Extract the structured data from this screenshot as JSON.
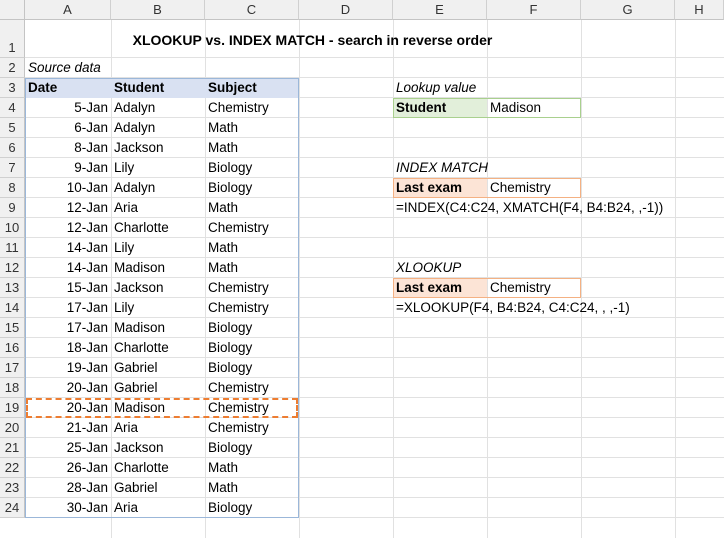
{
  "columns": [
    "A",
    "B",
    "C",
    "D",
    "E",
    "F",
    "G",
    "H"
  ],
  "rows": [
    "1",
    "2",
    "3",
    "4",
    "5",
    "6",
    "7",
    "8",
    "9",
    "10",
    "11",
    "12",
    "13",
    "14",
    "15",
    "16",
    "17",
    "18",
    "19",
    "20",
    "21",
    "22",
    "23",
    "24"
  ],
  "title": "XLOOKUP vs. INDEX MATCH - search in reverse order",
  "source_label": "Source data",
  "table": {
    "headers": [
      "Date",
      "Student",
      "Subject"
    ],
    "rows": [
      [
        "5-Jan",
        "Adalyn",
        "Chemistry"
      ],
      [
        "6-Jan",
        "Adalyn",
        "Math"
      ],
      [
        "8-Jan",
        "Jackson",
        "Math"
      ],
      [
        "9-Jan",
        "Lily",
        "Biology"
      ],
      [
        "10-Jan",
        "Adalyn",
        "Biology"
      ],
      [
        "12-Jan",
        "Aria",
        "Math"
      ],
      [
        "12-Jan",
        "Charlotte",
        "Chemistry"
      ],
      [
        "14-Jan",
        "Lily",
        "Math"
      ],
      [
        "14-Jan",
        "Madison",
        "Math"
      ],
      [
        "15-Jan",
        "Jackson",
        "Chemistry"
      ],
      [
        "17-Jan",
        "Lily",
        "Chemistry"
      ],
      [
        "17-Jan",
        "Madison",
        "Biology"
      ],
      [
        "18-Jan",
        "Charlotte",
        "Biology"
      ],
      [
        "19-Jan",
        "Gabriel",
        "Biology"
      ],
      [
        "20-Jan",
        "Gabriel",
        "Chemistry"
      ],
      [
        "20-Jan",
        "Madison",
        "Chemistry"
      ],
      [
        "21-Jan",
        "Aria",
        "Chemistry"
      ],
      [
        "25-Jan",
        "Jackson",
        "Biology"
      ],
      [
        "26-Jan",
        "Charlotte",
        "Math"
      ],
      [
        "28-Jan",
        "Gabriel",
        "Math"
      ],
      [
        "30-Jan",
        "Aria",
        "Biology"
      ]
    ]
  },
  "lookup": {
    "label": "Lookup value",
    "key": "Student",
    "value": "Madison"
  },
  "index_match": {
    "label": "INDEX MATCH",
    "key": "Last exam",
    "value": "Chemistry",
    "formula": "=INDEX(C4:C24, XMATCH(F4, B4:B24, ,-1))"
  },
  "xlookup": {
    "label": "XLOOKUP",
    "key": "Last exam",
    "value": "Chemistry",
    "formula": "=XLOOKUP(F4, B4:B24, C4:C24, , ,-1)"
  },
  "colors": {
    "header_fill": "#d9e1f2",
    "lookup_fill": "#e2efda",
    "result_fill": "#fce4d6",
    "highlight_border": "#ed7d31"
  }
}
